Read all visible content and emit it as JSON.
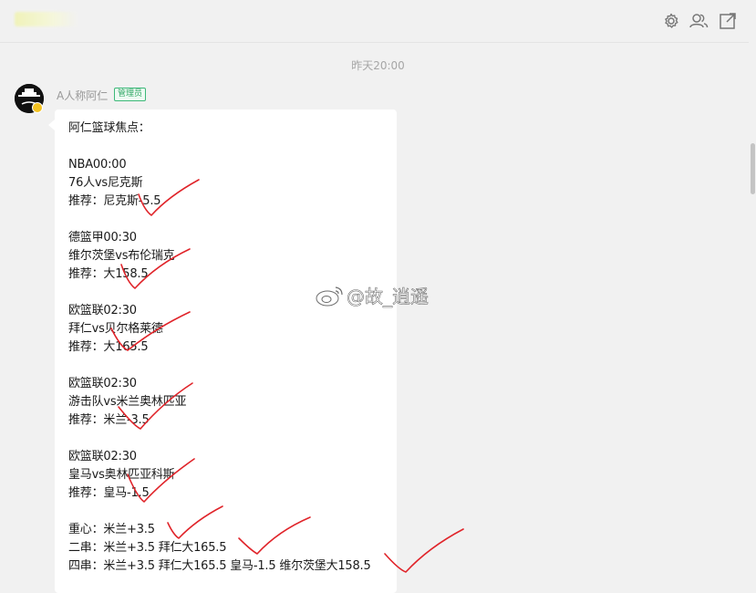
{
  "header": {
    "icons": [
      "gear-icon",
      "group-icon",
      "open-external-icon"
    ]
  },
  "chat": {
    "timestamp": "昨天20:00",
    "message": {
      "sender": "A人称阿仁",
      "role": "管理员",
      "lines": [
        "阿仁篮球焦点：",
        "",
        "NBA00:00",
        "76人vs尼克斯",
        "推荐：尼克斯-5.5",
        "",
        "德篮甲00:30",
        "维尔茨堡vs布伦瑞克",
        "推荐：大158.5",
        "",
        "欧篮联02:30",
        "拜仁vs贝尔格莱德",
        "推荐：大165.5",
        "",
        "欧篮联02:30",
        "游击队vs米兰奥林匹亚",
        "推荐：米兰-3.5",
        "",
        "欧篮联02:30",
        "皇马vs奥林匹亚科斯",
        "推荐：皇马-1.5",
        "",
        "重心：米兰+3.5",
        "二串：米兰+3.5 拜仁大165.5",
        "四串：米兰+3.5 拜仁大165.5 皇马-1.5 维尔茨堡大158.5"
      ]
    }
  },
  "watermark": "@故_逍遥",
  "colors": {
    "background": "#f1f1f1",
    "bubble": "#ffffff",
    "checkmark": "#e0242a",
    "role_badge": "#2fa764"
  }
}
